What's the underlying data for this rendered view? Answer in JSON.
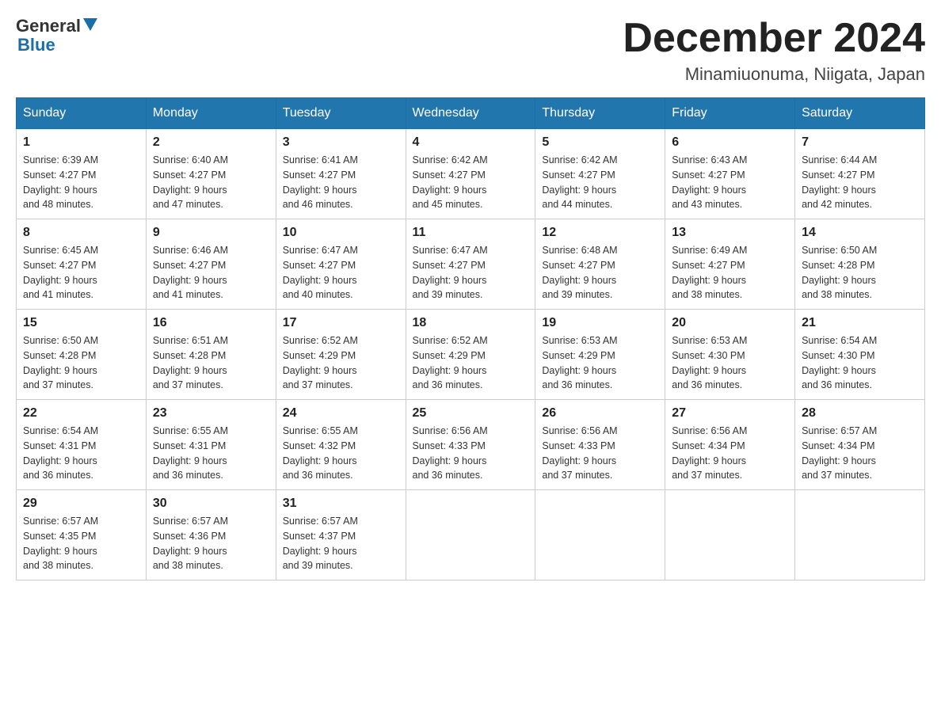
{
  "header": {
    "logo_general": "General",
    "logo_blue": "Blue",
    "month_title": "December 2024",
    "location": "Minamiuonuma, Niigata, Japan"
  },
  "days_of_week": [
    "Sunday",
    "Monday",
    "Tuesday",
    "Wednesday",
    "Thursday",
    "Friday",
    "Saturday"
  ],
  "weeks": [
    [
      {
        "day": "1",
        "sunrise": "6:39 AM",
        "sunset": "4:27 PM",
        "daylight": "9 hours and 48 minutes."
      },
      {
        "day": "2",
        "sunrise": "6:40 AM",
        "sunset": "4:27 PM",
        "daylight": "9 hours and 47 minutes."
      },
      {
        "day": "3",
        "sunrise": "6:41 AM",
        "sunset": "4:27 PM",
        "daylight": "9 hours and 46 minutes."
      },
      {
        "day": "4",
        "sunrise": "6:42 AM",
        "sunset": "4:27 PM",
        "daylight": "9 hours and 45 minutes."
      },
      {
        "day": "5",
        "sunrise": "6:42 AM",
        "sunset": "4:27 PM",
        "daylight": "9 hours and 44 minutes."
      },
      {
        "day": "6",
        "sunrise": "6:43 AM",
        "sunset": "4:27 PM",
        "daylight": "9 hours and 43 minutes."
      },
      {
        "day": "7",
        "sunrise": "6:44 AM",
        "sunset": "4:27 PM",
        "daylight": "9 hours and 42 minutes."
      }
    ],
    [
      {
        "day": "8",
        "sunrise": "6:45 AM",
        "sunset": "4:27 PM",
        "daylight": "9 hours and 41 minutes."
      },
      {
        "day": "9",
        "sunrise": "6:46 AM",
        "sunset": "4:27 PM",
        "daylight": "9 hours and 41 minutes."
      },
      {
        "day": "10",
        "sunrise": "6:47 AM",
        "sunset": "4:27 PM",
        "daylight": "9 hours and 40 minutes."
      },
      {
        "day": "11",
        "sunrise": "6:47 AM",
        "sunset": "4:27 PM",
        "daylight": "9 hours and 39 minutes."
      },
      {
        "day": "12",
        "sunrise": "6:48 AM",
        "sunset": "4:27 PM",
        "daylight": "9 hours and 39 minutes."
      },
      {
        "day": "13",
        "sunrise": "6:49 AM",
        "sunset": "4:27 PM",
        "daylight": "9 hours and 38 minutes."
      },
      {
        "day": "14",
        "sunrise": "6:50 AM",
        "sunset": "4:28 PM",
        "daylight": "9 hours and 38 minutes."
      }
    ],
    [
      {
        "day": "15",
        "sunrise": "6:50 AM",
        "sunset": "4:28 PM",
        "daylight": "9 hours and 37 minutes."
      },
      {
        "day": "16",
        "sunrise": "6:51 AM",
        "sunset": "4:28 PM",
        "daylight": "9 hours and 37 minutes."
      },
      {
        "day": "17",
        "sunrise": "6:52 AM",
        "sunset": "4:29 PM",
        "daylight": "9 hours and 37 minutes."
      },
      {
        "day": "18",
        "sunrise": "6:52 AM",
        "sunset": "4:29 PM",
        "daylight": "9 hours and 36 minutes."
      },
      {
        "day": "19",
        "sunrise": "6:53 AM",
        "sunset": "4:29 PM",
        "daylight": "9 hours and 36 minutes."
      },
      {
        "day": "20",
        "sunrise": "6:53 AM",
        "sunset": "4:30 PM",
        "daylight": "9 hours and 36 minutes."
      },
      {
        "day": "21",
        "sunrise": "6:54 AM",
        "sunset": "4:30 PM",
        "daylight": "9 hours and 36 minutes."
      }
    ],
    [
      {
        "day": "22",
        "sunrise": "6:54 AM",
        "sunset": "4:31 PM",
        "daylight": "9 hours and 36 minutes."
      },
      {
        "day": "23",
        "sunrise": "6:55 AM",
        "sunset": "4:31 PM",
        "daylight": "9 hours and 36 minutes."
      },
      {
        "day": "24",
        "sunrise": "6:55 AM",
        "sunset": "4:32 PM",
        "daylight": "9 hours and 36 minutes."
      },
      {
        "day": "25",
        "sunrise": "6:56 AM",
        "sunset": "4:33 PM",
        "daylight": "9 hours and 36 minutes."
      },
      {
        "day": "26",
        "sunrise": "6:56 AM",
        "sunset": "4:33 PM",
        "daylight": "9 hours and 37 minutes."
      },
      {
        "day": "27",
        "sunrise": "6:56 AM",
        "sunset": "4:34 PM",
        "daylight": "9 hours and 37 minutes."
      },
      {
        "day": "28",
        "sunrise": "6:57 AM",
        "sunset": "4:34 PM",
        "daylight": "9 hours and 37 minutes."
      }
    ],
    [
      {
        "day": "29",
        "sunrise": "6:57 AM",
        "sunset": "4:35 PM",
        "daylight": "9 hours and 38 minutes."
      },
      {
        "day": "30",
        "sunrise": "6:57 AM",
        "sunset": "4:36 PM",
        "daylight": "9 hours and 38 minutes."
      },
      {
        "day": "31",
        "sunrise": "6:57 AM",
        "sunset": "4:37 PM",
        "daylight": "9 hours and 39 minutes."
      },
      null,
      null,
      null,
      null
    ]
  ]
}
